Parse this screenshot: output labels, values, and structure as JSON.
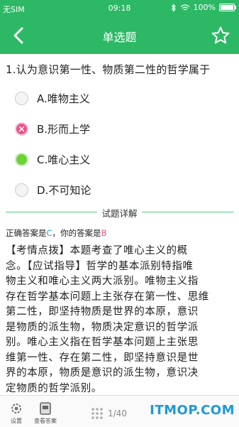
{
  "status_bar": {
    "carrier": "无SIM",
    "time": "09:18",
    "battery": "100%"
  },
  "nav": {
    "title": "单选题"
  },
  "question": {
    "text": "1.认为意识第一性、物质第二性的哲学属于",
    "options": [
      {
        "label": "A.唯物主义",
        "state": "none"
      },
      {
        "label": "B.形而上学",
        "state": "wrong"
      },
      {
        "label": "C.唯心主义",
        "state": "correct"
      },
      {
        "label": "D.不可知论",
        "state": "none"
      }
    ]
  },
  "details": {
    "section_title": "试题详解",
    "answer_prefix": "正确答案是",
    "correct_answer": "C",
    "answer_mid": "，你的答案是",
    "your_answer": "B",
    "explanation_lines": [
      "【考情点拨】本题考查了唯心主义的概",
      "念。【应试指导】哲学的基本派别特指唯",
      "物主义和唯心主义两大派别。唯物主义指",
      "存在哲学基本问题上主张存在第一性、思维",
      "第二性，即坚持物质是世界的本原，意识",
      "是物质的派生物，物质决定意识的哲学派",
      "别。唯心主义指在哲学基本问题上主张思",
      "维第一性、存在第二性，即坚持意识是世",
      "界的本原，物质是意识的派生物，意识决",
      "定物质的哲学派别。"
    ]
  },
  "bottom_bar": {
    "settings_label": "设置",
    "view_answer_label": "查看答案",
    "page_indicator": "1/40",
    "watermark": "ITMOP.COM"
  },
  "colors": {
    "brand_green": "#2db865",
    "correct_green": "#6dd13a",
    "wrong_pink": "#e8548a"
  }
}
